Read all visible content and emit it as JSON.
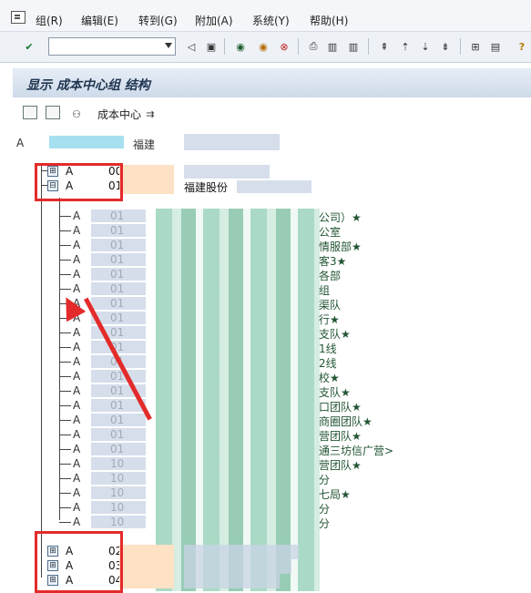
{
  "menu": {
    "items": [
      "组(R)",
      "编辑(E)",
      "转到(G)",
      "附加(A)",
      "系统(Y)",
      "帮助(H)"
    ]
  },
  "toolbar": {
    "buttons": [
      "check-icon",
      "back-icon",
      "save-icon",
      "back-icon",
      "exit-icon",
      "cancel-icon",
      "print-icon",
      "find-icon",
      "find-next-icon",
      "first-page-icon",
      "prev-page-icon",
      "next-page-icon",
      "last-page-icon",
      "layout-icon",
      "help-icon"
    ]
  },
  "page": {
    "title": "显示 成本中心组 结构"
  },
  "app_toolbar": {
    "cost_center_label": "成本中心"
  },
  "tree": {
    "root": {
      "id_prefix": "A",
      "name": "福建"
    },
    "groups": [
      {
        "expander": "⊞",
        "id_prefix": "A",
        "id_suffix": "00"
      },
      {
        "expander": "⊟",
        "id_prefix": "A",
        "id_suffix": "01",
        "name": "福建股份"
      },
      {
        "expander": "⊞",
        "id_prefix": "A",
        "id_suffix": "02"
      },
      {
        "expander": "⊞",
        "id_prefix": "A",
        "id_suffix": "03"
      },
      {
        "expander": "⊞",
        "id_prefix": "A",
        "id_suffix": "04"
      }
    ],
    "children": [
      {
        "id": "A",
        "suffix": "01",
        "side": "公司）★"
      },
      {
        "id": "A",
        "suffix": "01",
        "side": "公室"
      },
      {
        "id": "A",
        "suffix": "01",
        "side": "情服部★"
      },
      {
        "id": "A",
        "suffix": "01",
        "side": "客3★"
      },
      {
        "id": "A",
        "suffix": "01",
        "side": "各部"
      },
      {
        "id": "A",
        "suffix": "01",
        "side": "组"
      },
      {
        "id": "A",
        "suffix": "01",
        "side": "渠队"
      },
      {
        "id": "A",
        "suffix": "01",
        "side": "行★"
      },
      {
        "id": "A",
        "suffix": "01",
        "side": "支队★"
      },
      {
        "id": "A",
        "suffix": "01",
        "side": "1线"
      },
      {
        "id": "A",
        "suffix": "01",
        "side": "2线"
      },
      {
        "id": "A",
        "suffix": "01",
        "side": "校★"
      },
      {
        "id": "A",
        "suffix": "01",
        "side": "支队★"
      },
      {
        "id": "A",
        "suffix": "01",
        "side": "口团队★"
      },
      {
        "id": "A",
        "suffix": "01",
        "side": "商圈团队★"
      },
      {
        "id": "A",
        "suffix": "01",
        "side": "营团队★"
      },
      {
        "id": "A",
        "suffix": "01",
        "side": "通三坊信广营>"
      },
      {
        "id": "A",
        "suffix": "10",
        "side": "营团队★"
      },
      {
        "id": "A",
        "suffix": "10",
        "side": "分"
      },
      {
        "id": "A",
        "suffix": "10",
        "side": "七局★"
      },
      {
        "id": "A",
        "suffix": "10",
        "side": "分"
      },
      {
        "id": "A",
        "suffix": "10",
        "side": "分"
      }
    ]
  }
}
